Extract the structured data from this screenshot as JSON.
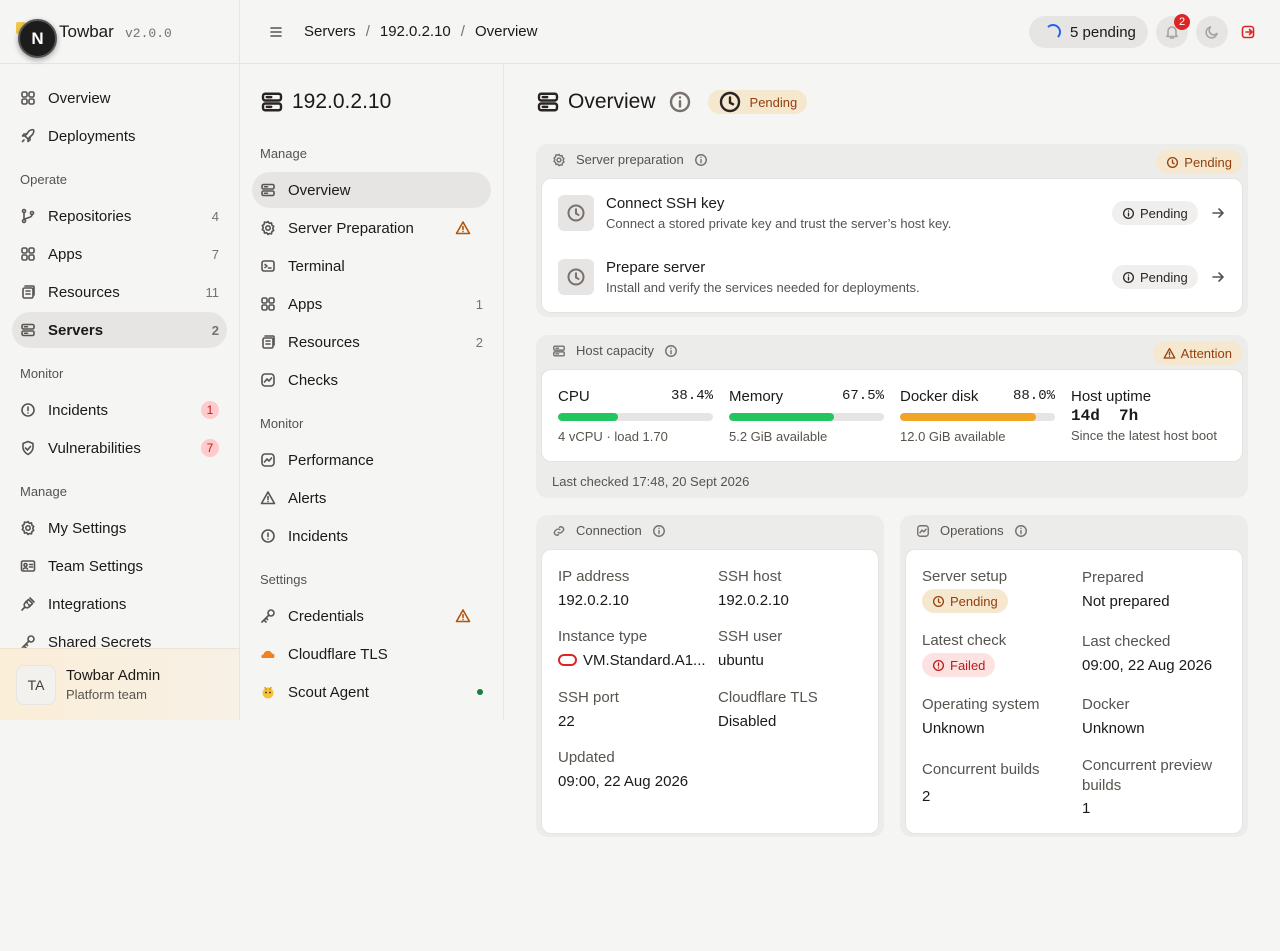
{
  "brand": {
    "name": "Towbar",
    "version": "v2.0.0",
    "avatar_letter": "N"
  },
  "sidebar": {
    "items_top": [
      {
        "label": "Overview",
        "icon": "grid-icon"
      },
      {
        "label": "Deployments",
        "icon": "rocket-icon"
      }
    ],
    "operate_label": "Operate",
    "operate": [
      {
        "label": "Repositories",
        "count": "4",
        "icon": "git-branch-icon"
      },
      {
        "label": "Apps",
        "count": "7",
        "icon": "grid-icon"
      },
      {
        "label": "Resources",
        "count": "11",
        "icon": "database-icon"
      },
      {
        "label": "Servers",
        "count": "2",
        "icon": "server-icon"
      }
    ],
    "monitor_label": "Monitor",
    "monitor": [
      {
        "label": "Incidents",
        "count": "1",
        "icon": "alert-circle-icon"
      },
      {
        "label": "Vulnerabilities",
        "count": "7",
        "icon": "shield-icon"
      }
    ],
    "manage_label": "Manage",
    "manage": [
      {
        "label": "My Settings",
        "icon": "gear-icon"
      },
      {
        "label": "Team Settings",
        "icon": "id-card-icon"
      },
      {
        "label": "Integrations",
        "icon": "plug-icon"
      },
      {
        "label": "Shared Secrets",
        "icon": "key-icon"
      }
    ],
    "user": {
      "initials": "TA",
      "name": "Towbar Admin",
      "team": "Platform team"
    }
  },
  "topbar": {
    "breadcrumbs": [
      "Servers",
      "192.0.2.10",
      "Overview"
    ],
    "pending_label": "5 pending",
    "notification_count": "2"
  },
  "subnav": {
    "title": "192.0.2.10",
    "manage_label": "Manage",
    "manage": [
      {
        "label": "Overview",
        "icon": "server-icon"
      },
      {
        "label": "Server Preparation",
        "icon": "gear-icon",
        "warning": true
      },
      {
        "label": "Terminal",
        "icon": "terminal-icon"
      },
      {
        "label": "Apps",
        "count": "1",
        "icon": "grid-icon"
      },
      {
        "label": "Resources",
        "count": "2",
        "icon": "database-icon"
      },
      {
        "label": "Checks",
        "icon": "activity-icon"
      }
    ],
    "monitor_label": "Monitor",
    "monitor": [
      {
        "label": "Performance",
        "icon": "activity-icon"
      },
      {
        "label": "Alerts",
        "icon": "alert-triangle-icon"
      },
      {
        "label": "Incidents",
        "icon": "alert-circle-icon"
      }
    ],
    "settings_label": "Settings",
    "settings": [
      {
        "label": "Credentials",
        "icon": "key-icon",
        "warning": true
      },
      {
        "label": "Cloudflare TLS",
        "icon": "cloudflare-icon"
      },
      {
        "label": "Scout Agent",
        "icon": "scout-icon",
        "status": "online"
      }
    ]
  },
  "page": {
    "title": "Overview",
    "status": "Pending",
    "preparation": {
      "title": "Server preparation",
      "status": "Pending",
      "steps": [
        {
          "title": "Connect SSH key",
          "desc": "Connect a stored private key and trust the server’s host key.",
          "status": "Pending"
        },
        {
          "title": "Prepare server",
          "desc": "Install and verify the services needed for deployments.",
          "status": "Pending"
        }
      ]
    },
    "capacity": {
      "title": "Host capacity",
      "status": "Attention",
      "metrics": [
        {
          "label": "CPU",
          "value": "38.4%",
          "fraction": 0.384,
          "sub": "4 vCPU · load 1.70",
          "color": "#22c55e"
        },
        {
          "label": "Memory",
          "value": "67.5%",
          "fraction": 0.675,
          "sub": "5.2 GiB available",
          "color": "#22c55e"
        },
        {
          "label": "Docker disk",
          "value": "88.0%",
          "fraction": 0.88,
          "sub": "12.0 GiB available",
          "color": "#f0a526"
        }
      ],
      "uptime_label": "Host uptime",
      "uptime_value": "14d  7h",
      "uptime_sub": "Since the latest host boot",
      "last_checked": "Last checked 17:48, 20 Sept 2026"
    },
    "connection": {
      "title": "Connection",
      "ip_label": "IP address",
      "ip": "192.0.2.10",
      "host_label": "SSH host",
      "host": "192.0.2.10",
      "instance_label": "Instance type",
      "instance": "VM.Standard.A1...",
      "user_label": "SSH user",
      "user": "ubuntu",
      "port_label": "SSH port",
      "port": "22",
      "tls_label": "Cloudflare TLS",
      "tls": "Disabled",
      "updated_label": "Updated",
      "updated": "09:00, 22 Aug 2026"
    },
    "operations": {
      "title": "Operations",
      "setup_label": "Server setup",
      "setup": "Pending",
      "prepared_label": "Prepared",
      "prepared": "Not prepared",
      "check_label": "Latest check",
      "check": "Failed",
      "last_label": "Last checked",
      "last": "09:00, 22 Aug 2026",
      "os_label": "Operating system",
      "os": "Unknown",
      "docker_label": "Docker",
      "docker": "Unknown",
      "builds_label": "Concurrent builds",
      "builds": "2",
      "preview_label": "Concurrent preview builds",
      "preview": "1"
    }
  }
}
